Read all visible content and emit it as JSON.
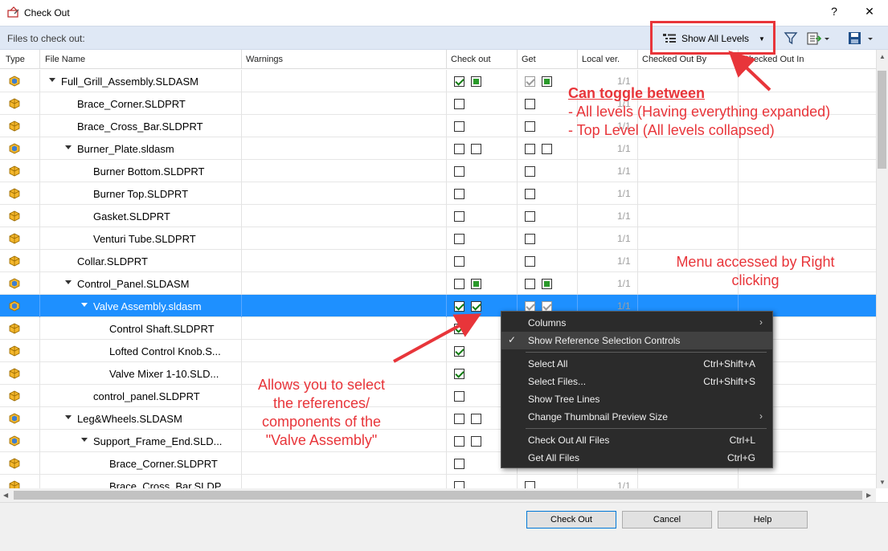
{
  "window": {
    "title": "Check Out",
    "help_glyph": "?",
    "close_glyph": "✕"
  },
  "toolbar": {
    "files_label": "Files to check out:",
    "levels_button_label": "Show All Levels"
  },
  "columns": {
    "type": "Type",
    "file_name": "File Name",
    "warnings": "Warnings",
    "check_out": "Check out",
    "get": "Get",
    "local_ver": "Local ver.",
    "checked_out_by": "Checked Out By",
    "checked_out_in": "Checked Out In"
  },
  "rows": [
    {
      "name": "Full_Grill_Assembly.SLDASM",
      "kind": "asm",
      "level": 0,
      "expander": true,
      "ver": "1/1"
    },
    {
      "name": "Brace_Corner.SLDPRT",
      "kind": "part",
      "level": 1,
      "expander": false,
      "ver": "1/1"
    },
    {
      "name": "Brace_Cross_Bar.SLDPRT",
      "kind": "part",
      "level": 1,
      "expander": false,
      "ver": "1/1"
    },
    {
      "name": "Burner_Plate.sldasm",
      "kind": "asm",
      "level": 1,
      "expander": true,
      "ver": "1/1"
    },
    {
      "name": "Burner Bottom.SLDPRT",
      "kind": "part",
      "level": 2,
      "expander": false,
      "ver": "1/1"
    },
    {
      "name": "Burner Top.SLDPRT",
      "kind": "part",
      "level": 2,
      "expander": false,
      "ver": "1/1"
    },
    {
      "name": "Gasket.SLDPRT",
      "kind": "part",
      "level": 2,
      "expander": false,
      "ver": "1/1"
    },
    {
      "name": "Venturi Tube.SLDPRT",
      "kind": "part",
      "level": 2,
      "expander": false,
      "ver": "1/1"
    },
    {
      "name": "Collar.SLDPRT",
      "kind": "part",
      "level": 1,
      "expander": false,
      "ver": "1/1"
    },
    {
      "name": "Control_Panel.SLDASM",
      "kind": "asm",
      "level": 1,
      "expander": true,
      "ver": "1/1"
    },
    {
      "name": "Valve Assembly.sldasm",
      "kind": "asm",
      "level": 2,
      "expander": true,
      "ver": "1/1",
      "selected": true
    },
    {
      "name": "Control Shaft.SLDPRT",
      "kind": "part",
      "level": 3,
      "expander": false,
      "ver": ""
    },
    {
      "name": "Lofted Control Knob.S...",
      "kind": "part",
      "level": 3,
      "expander": false,
      "ver": ""
    },
    {
      "name": "Valve Mixer 1-10.SLD...",
      "kind": "part",
      "level": 3,
      "expander": false,
      "ver": ""
    },
    {
      "name": "control_panel.SLDPRT",
      "kind": "part",
      "level": 2,
      "expander": false,
      "ver": ""
    },
    {
      "name": "Leg&Wheels.SLDASM",
      "kind": "asm",
      "level": 1,
      "expander": true,
      "ver": ""
    },
    {
      "name": "Support_Frame_End.SLD...",
      "kind": "asm",
      "level": 2,
      "expander": true,
      "ver": ""
    },
    {
      "name": "Brace_Corner.SLDPRT",
      "kind": "part",
      "level": 3,
      "expander": false,
      "ver": ""
    },
    {
      "name": "Brace_Cross_Bar.SLDP...",
      "kind": "part",
      "level": 3,
      "expander": false,
      "ver": "1/1"
    }
  ],
  "checkbox_states": {
    "checkout": [
      [
        "checked",
        "filled"
      ],
      [
        "empty"
      ],
      [
        "empty"
      ],
      [
        "empty",
        "empty"
      ],
      [
        "empty"
      ],
      [
        "empty"
      ],
      [
        "empty"
      ],
      [
        "empty"
      ],
      [
        "empty"
      ],
      [
        "empty",
        "filled"
      ],
      [
        "checked-white",
        "checked-white"
      ],
      [
        "checked"
      ],
      [
        "checked"
      ],
      [
        "checked"
      ],
      [
        "empty"
      ],
      [
        "empty",
        "empty"
      ],
      [
        "empty",
        "empty"
      ],
      [
        "empty"
      ],
      [
        "empty"
      ]
    ],
    "get": [
      [
        "grey-checked",
        "filled"
      ],
      [
        "empty"
      ],
      [
        "empty"
      ],
      [
        "empty",
        "empty"
      ],
      [
        "empty"
      ],
      [
        "empty"
      ],
      [
        "empty"
      ],
      [
        "empty"
      ],
      [
        "empty"
      ],
      [
        "empty",
        "filled"
      ],
      [
        "grey-checked",
        "grey-checked"
      ],
      [],
      [],
      [],
      [],
      [],
      [],
      [],
      [
        "empty"
      ]
    ]
  },
  "context_menu": {
    "items": [
      {
        "label": "Columns",
        "shortcut": "",
        "submenu": true,
        "checked": false
      },
      {
        "label": "Show Reference Selection Controls",
        "shortcut": "",
        "submenu": false,
        "checked": true
      },
      {
        "label": "Select All",
        "shortcut": "Ctrl+Shift+A",
        "submenu": false,
        "checked": false
      },
      {
        "label": "Select Files...",
        "shortcut": "Ctrl+Shift+S",
        "submenu": false,
        "checked": false
      },
      {
        "label": "Show Tree Lines",
        "shortcut": "",
        "submenu": false,
        "checked": false
      },
      {
        "label": "Change Thumbnail Preview Size",
        "shortcut": "",
        "submenu": true,
        "checked": false
      },
      {
        "label": "Check Out All Files",
        "shortcut": "Ctrl+L",
        "submenu": false,
        "checked": false
      },
      {
        "label": "Get All Files",
        "shortcut": "Ctrl+G",
        "submenu": false,
        "checked": false
      }
    ]
  },
  "footer": {
    "checkout_label": "Check Out",
    "cancel_label": "Cancel",
    "help_label": "Help"
  },
  "annotations": {
    "toggle_title": "Can toggle between",
    "toggle_line1": "- All levels (Having everything expanded)",
    "toggle_line2": "- Top Level (All levels collapsed)",
    "menu_line1": "Menu accessed by Right",
    "menu_line2": "clicking",
    "allows_line1": "Allows you to select",
    "allows_line2": "the references/",
    "allows_line3": "components of the",
    "allows_line4": "\"Valve Assembly\""
  },
  "colors": {
    "selection": "#1e90ff",
    "annotation_red": "#e8353a",
    "toolbar_bg": "#dfe8f5",
    "menu_bg": "#2b2b2b"
  }
}
